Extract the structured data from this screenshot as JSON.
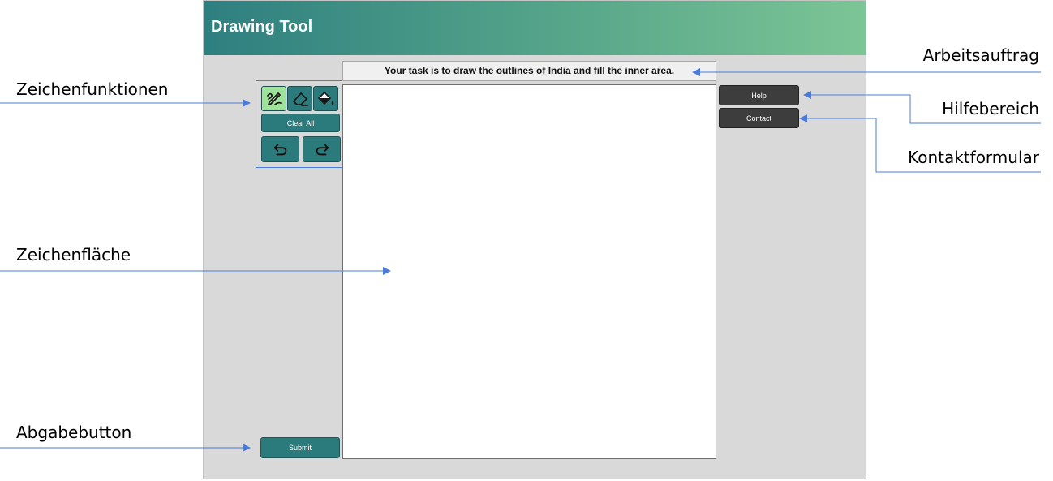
{
  "app": {
    "title": "Drawing Tool",
    "task": "Your task is to draw the outlines of India and fill the inner area."
  },
  "tools": [
    {
      "name": "pencil",
      "icon": "pencil-icon",
      "active": true
    },
    {
      "name": "eraser",
      "icon": "eraser-icon",
      "active": false
    },
    {
      "name": "fill",
      "icon": "paint-bucket-icon",
      "active": false
    }
  ],
  "buttons": {
    "clear_all": "Clear All",
    "undo_icon": "undo-icon",
    "redo_icon": "redo-icon",
    "help": "Help",
    "contact": "Contact",
    "submit": "Submit"
  },
  "callouts": {
    "drawing_functions": "Zeichenfunktionen",
    "drawing_area": "Zeichenfläche",
    "submit_button": "Abgabebutton",
    "task": "Arbeitsauftrag",
    "help_area": "Hilfebereich",
    "contact_form": "Kontaktformular"
  },
  "colors": {
    "header_start": "#2e7f80",
    "header_end": "#7cc596",
    "tool_teal": "#2c7b7c",
    "tool_active": "#9fe39b",
    "callout_line": "#4a7bd8"
  }
}
